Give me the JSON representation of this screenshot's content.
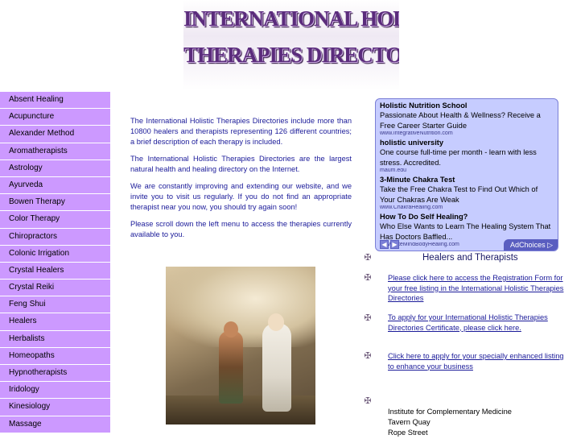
{
  "header": {
    "logo_line1": "INTERNATIONAL HOLISTIC",
    "logo_line2": "THERAPIES DIRECTORIES"
  },
  "sidebar": {
    "items": [
      "Absent Healing",
      "Acupuncture",
      "Alexander Method",
      "Aromatherapists",
      "Astrology",
      "Ayurveda",
      "Bowen Therapy",
      "Color Therapy",
      "Chiropractors",
      "Colonic Irrigation",
      "Crystal Healers",
      "Crystal Reiki",
      "Feng Shui",
      "Healers",
      "Herbalists",
      "Homeopaths",
      "Hypnotherapists",
      "Iridology",
      "Kinesiology",
      "Massage"
    ]
  },
  "intro": {
    "p1": "The International Holistic Therapies Directories include more than 10800 healers and therapists representing 126 different countries; a brief description of each therapy is included.",
    "p2": "The International Holistic Therapies Directories are the largest natural health and healing directory on the Internet.",
    "p3": "We are constantly improving and extending our website, and we invite you to visit us regularly.  If you do not find an appropriate therapist near you now, you should try again soon!",
    "p4": "Please scroll down the left menu to access the therapies currently available to you."
  },
  "ads": [
    {
      "title": "Holistic Nutrition School",
      "desc": "Passionate About Health & Wellness? Receive a Free Career Starter Guide",
      "url": "www.IntegrativeNutrition.com"
    },
    {
      "title": "holistic university",
      "desc": "One course full-time per month - learn with less stress. Accredited.",
      "url": "maum.edu"
    },
    {
      "title": "3-Minute Chakra Test",
      "desc": "Take the Free Chakra Test to Find Out Which of Your Chakras Are Weak",
      "url": "www.ChakraHealing.com"
    },
    {
      "title": "How To Do Self Healing?",
      "desc": "Who Else Wants to Learn The Healing System That Has Doctors Baffled...",
      "url": "www.SiteMindBodyHealing.com"
    }
  ],
  "adchoices_label": "AdChoices ▷",
  "ad_prev_label": "◀",
  "ad_next_label": "▶",
  "right": {
    "heading": "Healers and Therapists",
    "link1": "Please click here to access the Registration Form for your free listing in the International Holistic Therapies Directories",
    "link2": "To apply for your International Holistic Therapies Directories Certificate, please click here.",
    "link3": "Click here to apply for your specially enhanced listing to enhance your business",
    "address_line1": "Institute for Complementary Medicine",
    "address_line2": "Tavern Quay",
    "address_line3": "Rope Street"
  },
  "colors": {
    "sidebar_bg": "#cc99ff",
    "link_text": "#1a1a99",
    "ad_bg": "#c6ccff",
    "logo_purple": "#5b2c7c"
  }
}
